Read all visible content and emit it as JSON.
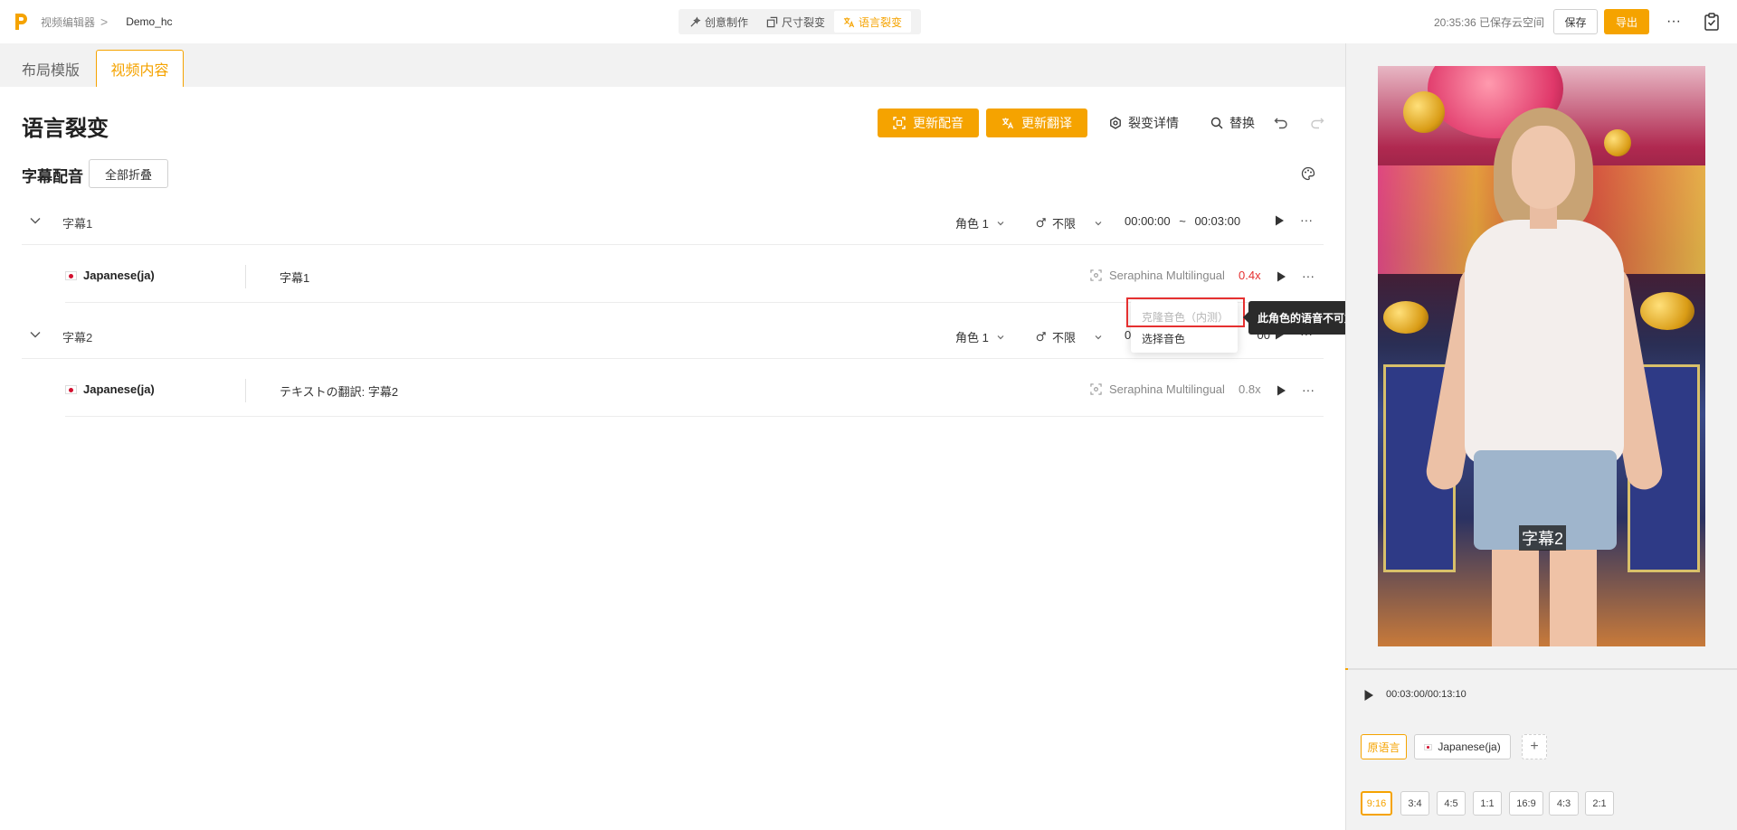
{
  "topbar": {
    "breadcrumb_root": "视频编辑器",
    "breadcrumb_sep": ">",
    "project_name": "Demo_hc",
    "modes": [
      {
        "label": "创意制作",
        "icon": "magic-icon",
        "active": false
      },
      {
        "label": "尺寸裂变",
        "icon": "resize-icon",
        "active": false
      },
      {
        "label": "语言裂变",
        "icon": "translate-icon",
        "active": true
      }
    ],
    "save_status": "20:35:36 已保存云空间",
    "save_label": "保存",
    "export_label": "导出",
    "more_label": "···",
    "accent_color": "#f5a300"
  },
  "left": {
    "tabs": [
      "布局模版",
      "视频内容"
    ],
    "active_tab": "视频内容",
    "page_title": "语言裂变",
    "update_dub_label": "更新配音",
    "update_translation_label": "更新翻译",
    "detail_label": "裂变详情",
    "replace_label": "替换",
    "section_title": "字幕配音",
    "collapse_all_label": "全部折叠",
    "subtitles": [
      {
        "name": "字幕1",
        "role": "角色 1",
        "gender": "不限",
        "start": "00:00:00",
        "tilde": "~",
        "end": "00:03:00",
        "more": "···",
        "translation": {
          "language": "Japanese(ja)",
          "text": "字幕1",
          "voice": "Seraphina Multilingual",
          "speed": "0.4x",
          "speed_color": "#e53030",
          "more": "···"
        }
      },
      {
        "name": "字幕2",
        "role": "角色 1",
        "gender": "不限",
        "start": "0",
        "tilde": "",
        "end": "00",
        "more": "···",
        "translation": {
          "language": "Japanese(ja)",
          "text": "テキストの翻訳: 字幕2",
          "voice": "Seraphina Multilingual",
          "speed": "0.8x",
          "speed_color": "#888888",
          "more": "···"
        }
      }
    ],
    "context_menu": {
      "clone_label": "克隆音色（内测）",
      "select_label": "选择音色"
    },
    "tooltip": "此角色的语音不可复制，无法使用语音克隆功能。"
  },
  "right": {
    "subtitle_overlay": "字幕2",
    "player_time": "00:03:00/00:13:10",
    "progress": 0.23,
    "languages": {
      "original": "原语言",
      "selected": "Japanese(ja)",
      "add": "+"
    },
    "ratios": [
      "9:16",
      "3:4",
      "4:5",
      "1:1",
      "16:9",
      "4:3",
      "2:1"
    ],
    "active_ratio": "9:16"
  }
}
